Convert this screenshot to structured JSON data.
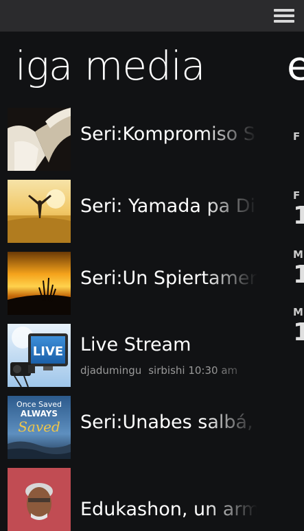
{
  "header": {
    "menu_icon": "hamburger-menu-icon"
  },
  "pivot": {
    "title": "iga media",
    "next_title_peek": "e"
  },
  "media": {
    "items": [
      {
        "title": "Seri:Kompromiso S",
        "thumb": "bible-hands-image"
      },
      {
        "title": "Seri: Yamada pa Di",
        "thumb": "wheat-field-sunrise-image"
      },
      {
        "title": "Seri:Un Spiertamer",
        "thumb": "sunset-grass-image"
      },
      {
        "title": "Live Stream",
        "thumb": "live-tv-camera-image",
        "subtitle": [
          "djadumingu",
          "sirbishi 10:30 am"
        ]
      },
      {
        "title": "Seri:Unabes salbá,",
        "thumb": "once-saved-always-saved-image",
        "thumb_text": [
          "Once Saved",
          "ALWAYS",
          "Saved"
        ]
      },
      {
        "title": "Edukashon, un arm",
        "thumb": "speaker-portrait-image"
      }
    ]
  },
  "peek": {
    "labels": [
      "F",
      "F",
      "M",
      "M"
    ],
    "numbers": [
      "1",
      "1",
      "1"
    ]
  },
  "colors": {
    "background": "#111214",
    "topbar": "#2b2b2d",
    "subtext": "#9a9a9a"
  }
}
